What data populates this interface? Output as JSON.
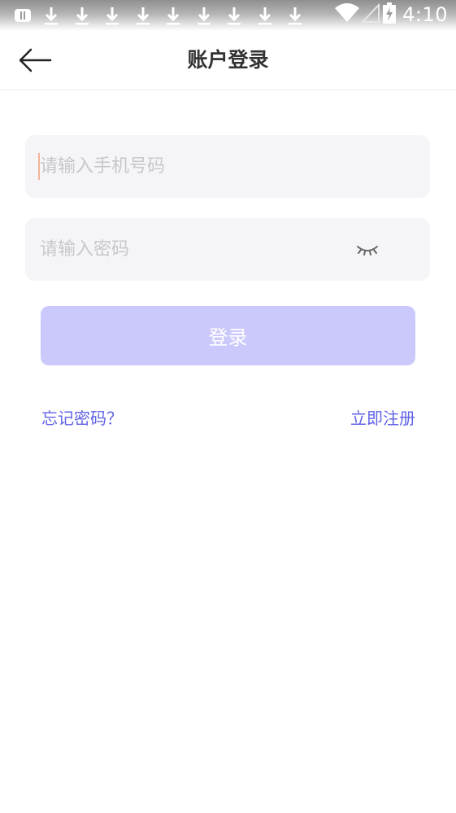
{
  "status_bar": {
    "time": "4:10",
    "download_notifications": 9,
    "icons": [
      "notification-badge-icon",
      "download-icon",
      "wifi-icon",
      "signal-icon",
      "battery-charging-icon"
    ]
  },
  "header": {
    "title": "账户登录",
    "back_icon": "back-arrow-icon"
  },
  "form": {
    "phone": {
      "placeholder": "请输入手机号码",
      "value": ""
    },
    "password": {
      "placeholder": "请输入密码",
      "value": "",
      "visibility_icon": "eye-closed-icon"
    },
    "login_label": "登录"
  },
  "links": {
    "forgot_password": "忘记密码？",
    "register": "立即注册"
  },
  "colors": {
    "accent": "#6163e6",
    "button_disabled": "#cbc9fb",
    "field_background": "#f5f5f8",
    "caret": "#f3b49a"
  }
}
